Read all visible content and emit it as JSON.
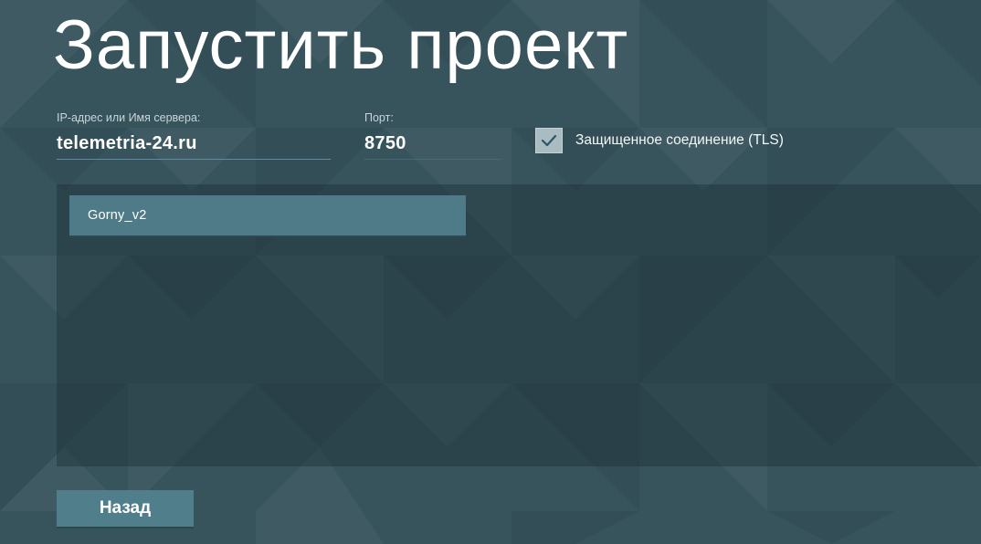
{
  "page": {
    "title": "Запустить проект"
  },
  "connection": {
    "host_label": "IP-адрес или Имя сервера:",
    "host_value": "telemetria-24.ru",
    "port_label": "Порт:",
    "port_value": "8750",
    "tls_label": "Защищенное соединение (TLS)",
    "tls_checked": true
  },
  "projects": [
    {
      "name": "Gorny_v2"
    }
  ],
  "actions": {
    "back_label": "Назад"
  },
  "colors": {
    "background": "#37535c",
    "accent": "#507e8b",
    "checkbox": "#a9bcc1",
    "check_mark": "#2f5568"
  }
}
